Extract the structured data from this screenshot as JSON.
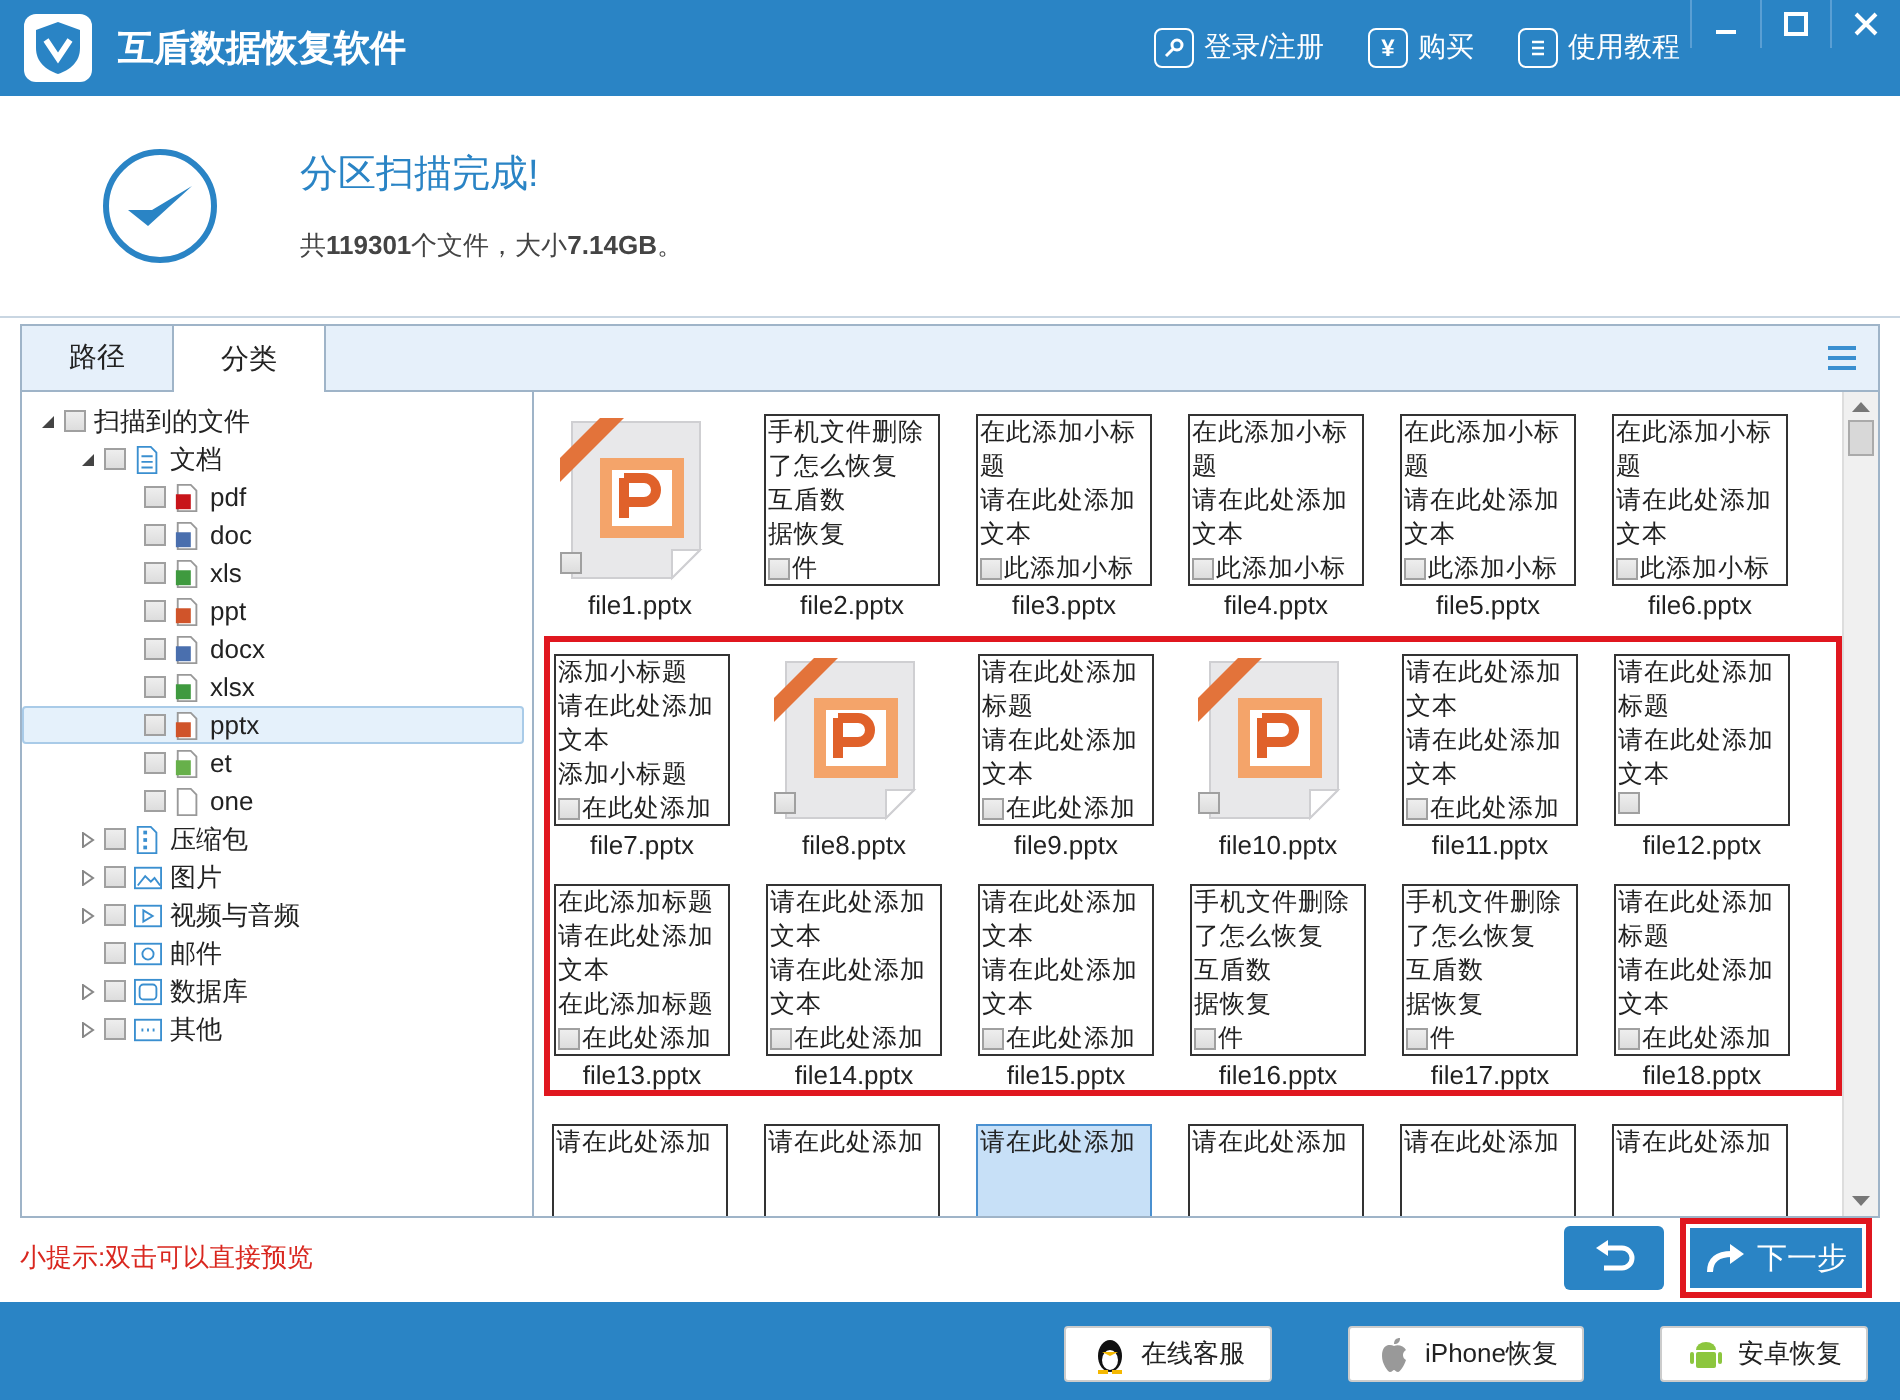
{
  "window": {
    "title": "互盾数据恢复软件",
    "actions": [
      {
        "kind": "key",
        "label": "登录/注册"
      },
      {
        "kind": "yen",
        "glyph": "¥",
        "label": "购买"
      },
      {
        "kind": "book",
        "label": "使用教程"
      }
    ]
  },
  "scan": {
    "title": "分区扫描完成!",
    "summary": "共**119301**个文件，大小**7.14GB**。"
  },
  "tabs": [
    {
      "label": "路径",
      "selected": false
    },
    {
      "label": "分类",
      "selected": true
    }
  ],
  "tree": {
    "items": [
      {
        "label": "扫描到的文件",
        "checked": false,
        "selected": false,
        "expanded": true,
        "children": [
          {
            "label": "文档",
            "kind": "document",
            "checked": false,
            "selected": false,
            "expanded": true,
            "children": [
              {
                "label": "pdf",
                "kind": "pdf",
                "checked": false,
                "selected": false
              },
              {
                "label": "doc",
                "kind": "word",
                "checked": false,
                "selected": false
              },
              {
                "label": "xls",
                "kind": "excel",
                "checked": false,
                "selected": false
              },
              {
                "label": "ppt",
                "kind": "ppt",
                "checked": false,
                "selected": false
              },
              {
                "label": "docx",
                "kind": "word",
                "checked": false,
                "selected": false
              },
              {
                "label": "xlsx",
                "kind": "excel",
                "checked": false,
                "selected": false
              },
              {
                "label": "pptx",
                "kind": "ppt",
                "checked": false,
                "selected": true
              },
              {
                "label": "et",
                "kind": "et",
                "checked": false,
                "selected": false
              },
              {
                "label": "one",
                "kind": "blank",
                "checked": false,
                "selected": false
              }
            ]
          },
          {
            "label": "压缩包",
            "kind": "archive",
            "checked": false,
            "selected": false,
            "expanded": false
          },
          {
            "label": "图片",
            "kind": "image",
            "checked": false,
            "selected": false,
            "expanded": false
          },
          {
            "label": "视频与音频",
            "kind": "video",
            "checked": false,
            "selected": false,
            "expanded": false
          },
          {
            "label": "邮件",
            "kind": "mail",
            "checked": false,
            "selected": false
          },
          {
            "label": "数据库",
            "kind": "database",
            "checked": false,
            "selected": false,
            "expanded": false
          },
          {
            "label": "其他",
            "kind": "other",
            "checked": false,
            "selected": false,
            "expanded": false
          }
        ]
      }
    ]
  },
  "grid": {
    "rows": [
      {
        "highlighted": false,
        "items": [
          {
            "kind": "icon",
            "name": "file1.pptx",
            "checked": false
          },
          {
            "kind": "text",
            "name": "file2.pptx",
            "lines": [
              "手机文件删除",
              "了怎么恢复",
              "互盾数",
              "据恢复"
            ],
            "last_line": "件",
            "checked": false,
            "selected": false
          },
          {
            "kind": "text",
            "name": "file3.pptx",
            "lines": [
              "在此添加小标",
              "题",
              "请在此处添加",
              "文本"
            ],
            "last_line": "此添加小标",
            "checked": false,
            "selected": false
          },
          {
            "kind": "text",
            "name": "file4.pptx",
            "lines": [
              "在此添加小标",
              "题",
              "请在此处添加",
              "文本"
            ],
            "last_line": "此添加小标",
            "checked": false,
            "selected": false
          },
          {
            "kind": "text",
            "name": "file5.pptx",
            "lines": [
              "在此添加小标",
              "题",
              "请在此处添加",
              "文本"
            ],
            "last_line": "此添加小标",
            "checked": false,
            "selected": false
          },
          {
            "kind": "text",
            "name": "file6.pptx",
            "lines": [
              "在此添加小标",
              "题",
              "请在此处添加",
              "文本"
            ],
            "last_line": "此添加小标",
            "checked": false,
            "selected": false
          }
        ]
      },
      {
        "highlighted": true,
        "items": [
          {
            "kind": "text",
            "name": "file7.pptx",
            "lines": [
              "添加小标题",
              "请在此处添加",
              "文本",
              "添加小标题"
            ],
            "last_line": "在此处添加",
            "checked": false,
            "selected": false
          },
          {
            "kind": "icon",
            "name": "file8.pptx",
            "checked": false
          },
          {
            "kind": "text",
            "name": "file9.pptx",
            "lines": [
              "请在此处添加",
              "标题",
              "请在此处添加",
              "文本"
            ],
            "last_line": "在此处添加",
            "checked": false,
            "selected": false
          },
          {
            "kind": "icon",
            "name": "file10.pptx",
            "checked": false
          },
          {
            "kind": "text",
            "name": "file11.pptx",
            "lines": [
              "请在此处添加",
              "文本",
              "请在此处添加",
              "文本"
            ],
            "last_line": "在此处添加",
            "checked": false,
            "selected": false
          },
          {
            "kind": "text",
            "name": "file12.pptx",
            "lines": [
              "请在此处添加",
              "标题",
              "请在此处添加",
              "文本"
            ],
            "checked": false,
            "selected": false
          }
        ]
      },
      {
        "highlighted": true,
        "items": [
          {
            "kind": "text",
            "name": "file13.pptx",
            "lines": [
              "在此添加标题",
              "请在此处添加",
              "文本",
              "在此添加标题"
            ],
            "last_line": "在此处添加",
            "checked": false,
            "selected": false
          },
          {
            "kind": "text",
            "name": "file14.pptx",
            "lines": [
              "请在此处添加",
              "文本",
              "请在此处添加",
              "文本"
            ],
            "last_line": "在此处添加",
            "checked": false,
            "selected": false
          },
          {
            "kind": "text",
            "name": "file15.pptx",
            "lines": [
              "请在此处添加",
              "文本",
              "请在此处添加",
              "文本"
            ],
            "last_line": "在此处添加",
            "checked": false,
            "selected": false
          },
          {
            "kind": "text",
            "name": "file16.pptx",
            "lines": [
              "手机文件删除",
              "了怎么恢复",
              "互盾数",
              "据恢复"
            ],
            "last_line": "件",
            "checked": false,
            "selected": false
          },
          {
            "kind": "text",
            "name": "file17.pptx",
            "lines": [
              "手机文件删除",
              "了怎么恢复",
              "互盾数",
              "据恢复"
            ],
            "last_line": "件",
            "checked": false,
            "selected": false
          },
          {
            "kind": "text",
            "name": "file18.pptx",
            "lines": [
              "请在此处添加",
              "标题",
              "请在此处添加",
              "文本"
            ],
            "last_line": "在此处添加",
            "checked": false,
            "selected": false
          }
        ]
      },
      {
        "highlighted": false,
        "items": [
          {
            "kind": "text",
            "lines": [
              "请在此处添加"
            ],
            "selected": false
          },
          {
            "kind": "text",
            "lines": [
              "请在此处添加"
            ],
            "selected": false
          },
          {
            "kind": "text",
            "lines": [
              "请在此处添加"
            ],
            "selected": true
          },
          {
            "kind": "text",
            "lines": [
              "请在此处添加"
            ],
            "selected": false
          },
          {
            "kind": "text",
            "lines": [
              "请在此处添加"
            ],
            "selected": false
          },
          {
            "kind": "text",
            "lines": [
              "请在此处添加"
            ],
            "selected": false
          }
        ]
      }
    ]
  },
  "hint": "小提示:双击可以直接预览",
  "next_button": {
    "label": "下一步",
    "highlighted": true
  },
  "footer_buttons": [
    {
      "kind": "penguin",
      "label": "在线客服"
    },
    {
      "kind": "apple",
      "label": "iPhone恢复"
    },
    {
      "kind": "android",
      "label": "安卓恢复"
    }
  ]
}
